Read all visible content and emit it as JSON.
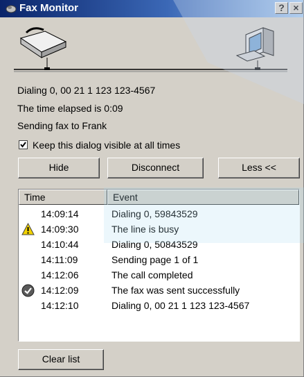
{
  "window": {
    "title": "Fax Monitor",
    "help_label": "?",
    "close_label": "×"
  },
  "status": {
    "dialing": "Dialing 0, 00 21 1 123 123-4567",
    "elapsed": "The time elapsed is 0:09",
    "sending": "Sending fax to Frank"
  },
  "checkbox": {
    "label": "Keep this dialog visible at all times",
    "checked": true
  },
  "buttons": {
    "hide": "Hide",
    "disconnect": "Disconnect",
    "less": "Less <<",
    "clear": "Clear list"
  },
  "list": {
    "columns": [
      "Time",
      "Event"
    ],
    "rows": [
      {
        "time": "14:09:14",
        "event": "Dialing 0, 59843529",
        "icon": "none"
      },
      {
        "time": "14:09:30",
        "event": "The line is busy",
        "icon": "warning-icon"
      },
      {
        "time": "14:10:44",
        "event": "Dialing 0, 50843529",
        "icon": "none"
      },
      {
        "time": "14:11:09",
        "event": "Sending page 1 of 1",
        "icon": "none"
      },
      {
        "time": "14:12:06",
        "event": "The call completed",
        "icon": "none"
      },
      {
        "time": "14:12:09",
        "event": "The fax was sent successfully",
        "icon": "success-check-icon"
      },
      {
        "time": "14:12:10",
        "event": "Dialing 0, 00 21 1 123 123-4567",
        "icon": "none"
      }
    ]
  },
  "colors": {
    "titlebar_start": "#0a246a",
    "titlebar_end": "#a6caf0",
    "face": "#d4d0c8"
  }
}
